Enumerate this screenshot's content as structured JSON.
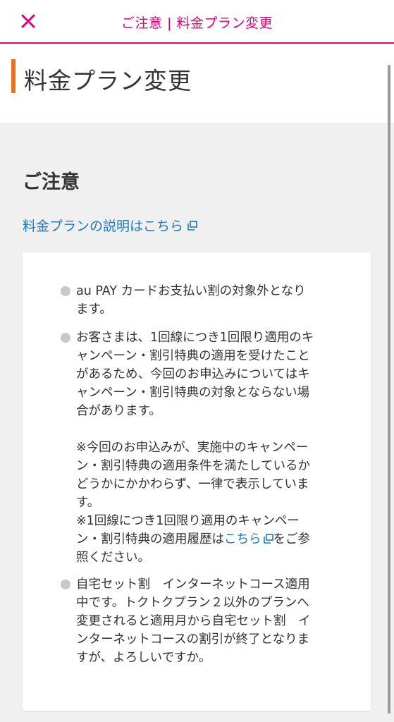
{
  "topbar": {
    "title": "ご注意 | 料金プラン変更",
    "close_icon": "close-icon",
    "accent_color": "#e0007a"
  },
  "page": {
    "title": "料金プラン変更",
    "heading_bar_color": "#e8731a"
  },
  "notice": {
    "heading": "ご注意",
    "plan_link_label": "料金プランの説明はこちら",
    "link_color": "#1a7bc0",
    "items": [
      {
        "lines": [
          "au PAY カードお支払い割の対象外となり",
          "ます。"
        ]
      },
      {
        "lines": [
          "お客さまは、1回線につき1回限り適用のキ",
          "ャンペーン・割引特典の適用を受けたこと",
          "があるため、今回のお申込みについてはキ",
          "ャンペーン・割引特典の対象とならない場",
          "合があります。"
        ],
        "note1_lines": [
          "※今回のお申込みが、実施中のキャンペー",
          "ン・割引特典の適用条件を満たしているか",
          "どうかにかかわらず、一律で表示していま",
          "す。"
        ],
        "note2_line1": "※1回線につき1回限り適用のキャンペー",
        "note2_line2_prefix": "ン・割引特典の適用履歴は",
        "note2_link": "こちら",
        "note2_line2_suffix": "をご参",
        "note2_line3": "照ください。"
      },
      {
        "lines": [
          "自宅セット割　インターネットコース適用",
          "中です。トクトクプラン２以外のプランへ",
          "変更されると適用月から自宅セット割　イ",
          "ンターネットコースの割引が終了となりま",
          "すが、よろしいですか。"
        ]
      }
    ]
  }
}
